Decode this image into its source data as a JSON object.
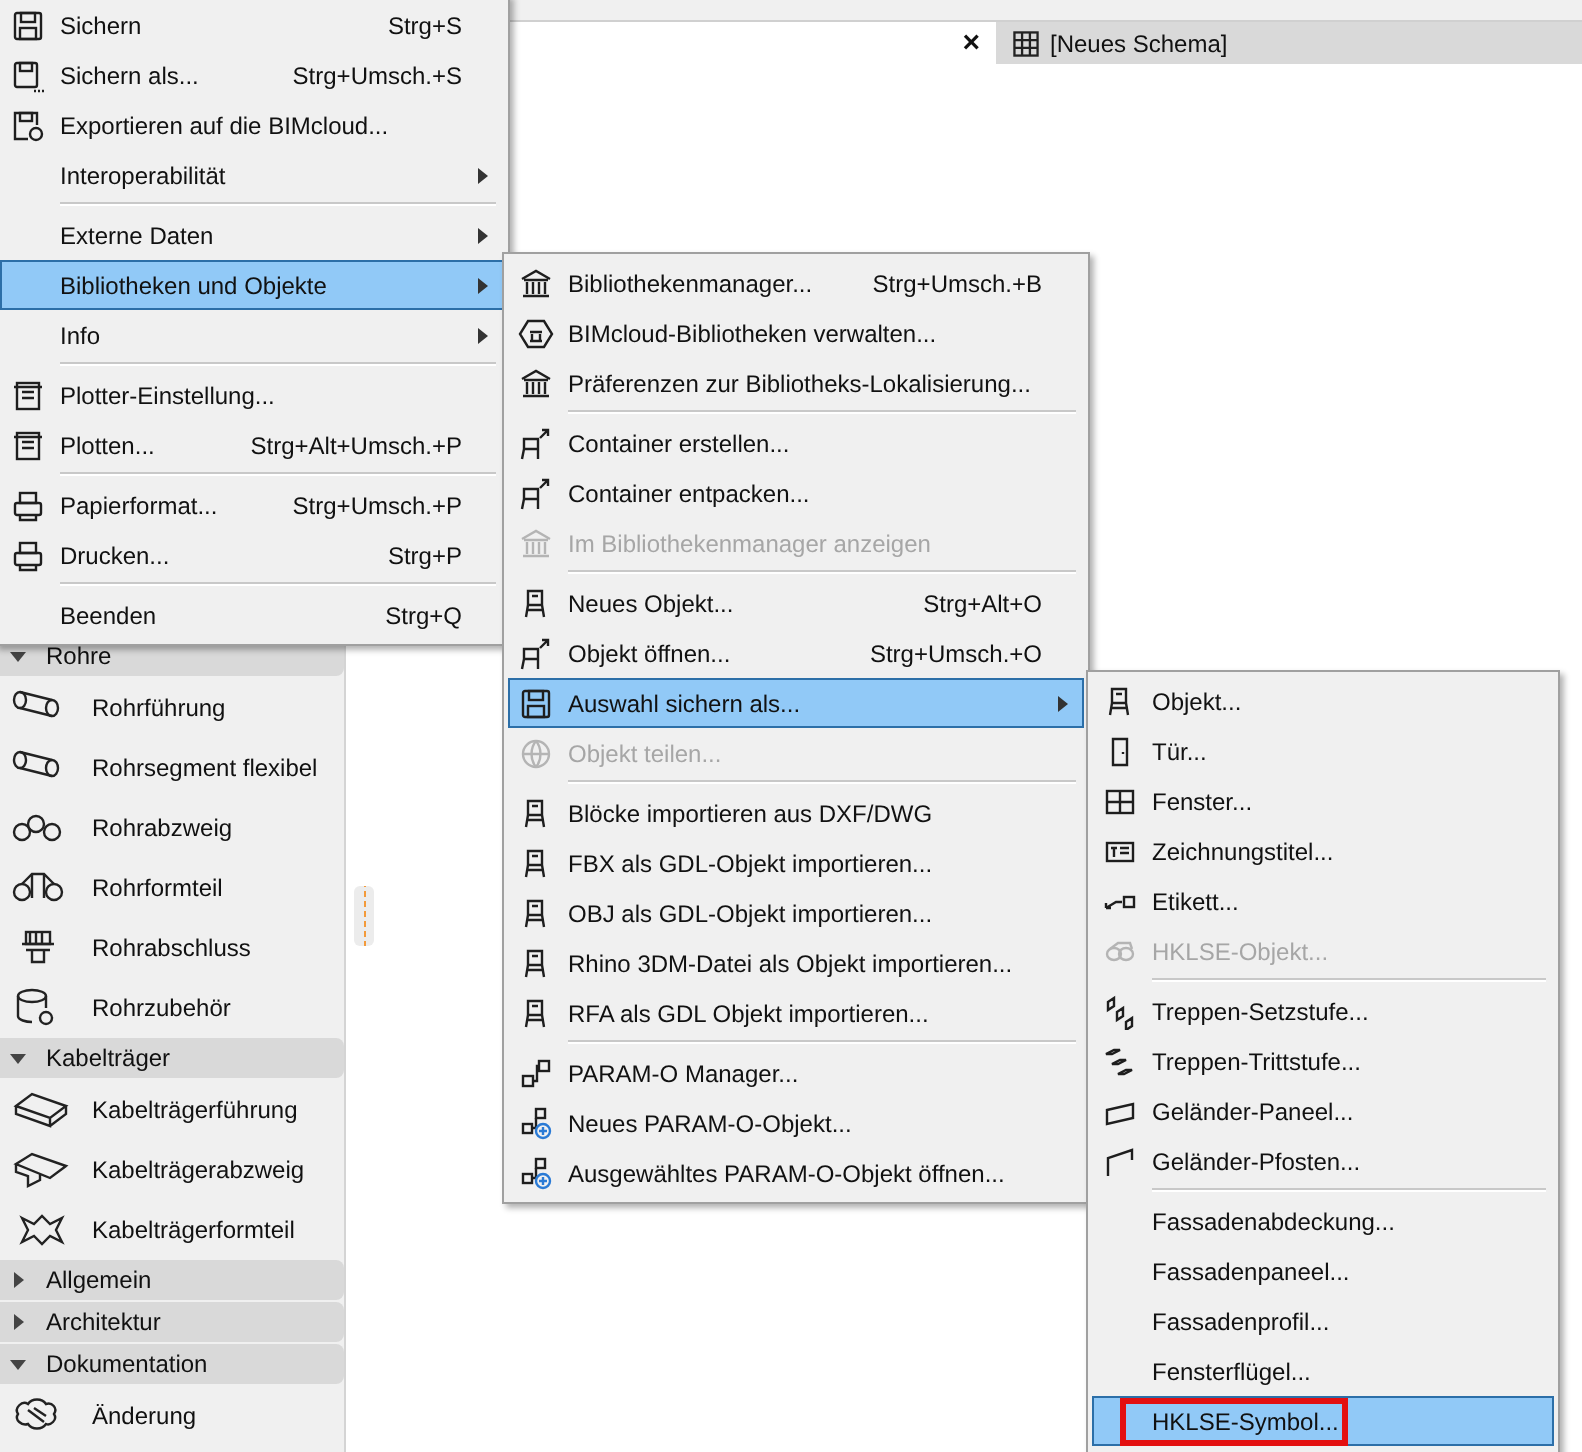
{
  "document_tabs": {
    "close": "×",
    "tabs": [
      {
        "label": "[Neues Schema]",
        "selected": false
      }
    ]
  },
  "sidebar": {
    "sections": [
      {
        "label": "Rohre",
        "expanded": true,
        "items": [
          {
            "label": "Rohrführung"
          },
          {
            "label": "Rohrsegment flexibel"
          },
          {
            "label": "Rohrabzweig"
          },
          {
            "label": "Rohrformteil"
          },
          {
            "label": "Rohrabschluss"
          },
          {
            "label": "Rohrzubehör"
          }
        ]
      },
      {
        "label": "Kabelträger",
        "expanded": true,
        "items": [
          {
            "label": "Kabelträgerführung"
          },
          {
            "label": "Kabelträgerabzweig"
          },
          {
            "label": "Kabelträgerformteil"
          }
        ]
      },
      {
        "label": "Allgemein",
        "expanded": false
      },
      {
        "label": "Architektur",
        "expanded": false
      },
      {
        "label": "Dokumentation",
        "expanded": true,
        "items": [
          {
            "label": "Änderung"
          }
        ]
      }
    ]
  },
  "file_menu": {
    "groups": [
      [
        {
          "label": "Sichern",
          "shortcut": "Strg+S",
          "submenu": false,
          "selected": false,
          "disabled": false
        },
        {
          "label": "Sichern als...",
          "shortcut": "Strg+Umsch.+S",
          "submenu": false,
          "selected": false,
          "disabled": false
        },
        {
          "label": "Exportieren auf die BIMcloud...",
          "submenu": false,
          "selected": false,
          "disabled": false
        },
        {
          "label": "Interoperabilität",
          "submenu": true,
          "selected": false,
          "disabled": false
        }
      ],
      [
        {
          "label": "Externe Daten",
          "submenu": true,
          "selected": false,
          "disabled": false
        },
        {
          "label": "Bibliotheken und Objekte",
          "submenu": true,
          "selected": true,
          "disabled": false
        },
        {
          "label": "Info",
          "submenu": true,
          "selected": false,
          "disabled": false
        }
      ],
      [
        {
          "label": "Plotter-Einstellung...",
          "submenu": false,
          "selected": false,
          "disabled": false
        },
        {
          "label": "Plotten...",
          "shortcut": "Strg+Alt+Umsch.+P",
          "submenu": false,
          "selected": false,
          "disabled": false
        }
      ],
      [
        {
          "label": "Papierformat...",
          "shortcut": "Strg+Umsch.+P",
          "submenu": false,
          "selected": false,
          "disabled": false
        },
        {
          "label": "Drucken...",
          "shortcut": "Strg+P",
          "submenu": false,
          "selected": false,
          "disabled": false
        }
      ],
      [
        {
          "label": "Beenden",
          "shortcut": "Strg+Q",
          "submenu": false,
          "selected": false,
          "disabled": false
        }
      ]
    ]
  },
  "libraries_submenu": {
    "groups": [
      [
        {
          "label": "Bibliothekenmanager...",
          "shortcut": "Strg+Umsch.+B",
          "submenu": false,
          "selected": false,
          "disabled": false
        },
        {
          "label": "BIMcloud-Bibliotheken verwalten...",
          "submenu": false,
          "selected": false,
          "disabled": false
        },
        {
          "label": "Präferenzen zur Bibliotheks-Lokalisierung...",
          "submenu": false,
          "selected": false,
          "disabled": false
        }
      ],
      [
        {
          "label": "Container erstellen...",
          "submenu": false,
          "selected": false,
          "disabled": false
        },
        {
          "label": "Container entpacken...",
          "submenu": false,
          "selected": false,
          "disabled": false
        },
        {
          "label": "Im Bibliothekenmanager anzeigen",
          "submenu": false,
          "selected": false,
          "disabled": true
        }
      ],
      [
        {
          "label": "Neues Objekt...",
          "shortcut": "Strg+Alt+O",
          "submenu": false,
          "selected": false,
          "disabled": false
        },
        {
          "label": "Objekt öffnen...",
          "shortcut": "Strg+Umsch.+O",
          "submenu": false,
          "selected": false,
          "disabled": false
        },
        {
          "label": "Auswahl sichern als...",
          "submenu": true,
          "selected": true,
          "disabled": false
        },
        {
          "label": "Objekt teilen...",
          "submenu": false,
          "selected": false,
          "disabled": true
        }
      ],
      [
        {
          "label": "Blöcke importieren aus DXF/DWG",
          "submenu": false,
          "selected": false,
          "disabled": false
        },
        {
          "label": "FBX als GDL-Objekt importieren...",
          "submenu": false,
          "selected": false,
          "disabled": false
        },
        {
          "label": "OBJ als GDL-Objekt importieren...",
          "submenu": false,
          "selected": false,
          "disabled": false
        },
        {
          "label": "Rhino 3DM-Datei als Objekt importieren...",
          "submenu": false,
          "selected": false,
          "disabled": false
        },
        {
          "label": "RFA als GDL Objekt importieren...",
          "submenu": false,
          "selected": false,
          "disabled": false
        }
      ],
      [
        {
          "label": "PARAM-O Manager...",
          "submenu": false,
          "selected": false,
          "disabled": false
        },
        {
          "label": "Neues PARAM-O-Objekt...",
          "submenu": false,
          "selected": false,
          "disabled": false
        },
        {
          "label": "Ausgewähltes PARAM-O-Objekt öffnen...",
          "submenu": false,
          "selected": false,
          "disabled": false
        }
      ]
    ]
  },
  "save_selection_submenu": {
    "groups": [
      [
        {
          "label": "Objekt...",
          "submenu": false,
          "selected": false,
          "disabled": false,
          "marked": false
        },
        {
          "label": "Tür...",
          "submenu": false,
          "selected": false,
          "disabled": false,
          "marked": false
        },
        {
          "label": "Fenster...",
          "submenu": false,
          "selected": false,
          "disabled": false,
          "marked": false
        },
        {
          "label": "Zeichnungstitel...",
          "submenu": false,
          "selected": false,
          "disabled": false,
          "marked": false
        },
        {
          "label": "Etikett...",
          "submenu": false,
          "selected": false,
          "disabled": false,
          "marked": false
        },
        {
          "label": "HKLSE-Objekt...",
          "submenu": false,
          "selected": false,
          "disabled": true,
          "marked": false
        }
      ],
      [
        {
          "label": "Treppen-Setzstufe...",
          "submenu": false,
          "selected": false,
          "disabled": false,
          "marked": false
        },
        {
          "label": "Treppen-Trittstufe...",
          "submenu": false,
          "selected": false,
          "disabled": false,
          "marked": false
        },
        {
          "label": "Geländer-Paneel...",
          "submenu": false,
          "selected": false,
          "disabled": false,
          "marked": false
        },
        {
          "label": "Geländer-Pfosten...",
          "submenu": false,
          "selected": false,
          "disabled": false,
          "marked": false
        }
      ],
      [
        {
          "label": "Fassadenabdeckung...",
          "submenu": false,
          "selected": false,
          "disabled": false,
          "marked": false
        },
        {
          "label": "Fassadenpaneel...",
          "submenu": false,
          "selected": false,
          "disabled": false,
          "marked": false
        },
        {
          "label": "Fassadenprofil...",
          "submenu": false,
          "selected": false,
          "disabled": false,
          "marked": false
        },
        {
          "label": "Fensterflügel...",
          "submenu": false,
          "selected": false,
          "disabled": false,
          "marked": false
        },
        {
          "label": "HKLSE-Symbol...",
          "submenu": false,
          "selected": true,
          "disabled": false,
          "marked": true
        }
      ]
    ]
  }
}
